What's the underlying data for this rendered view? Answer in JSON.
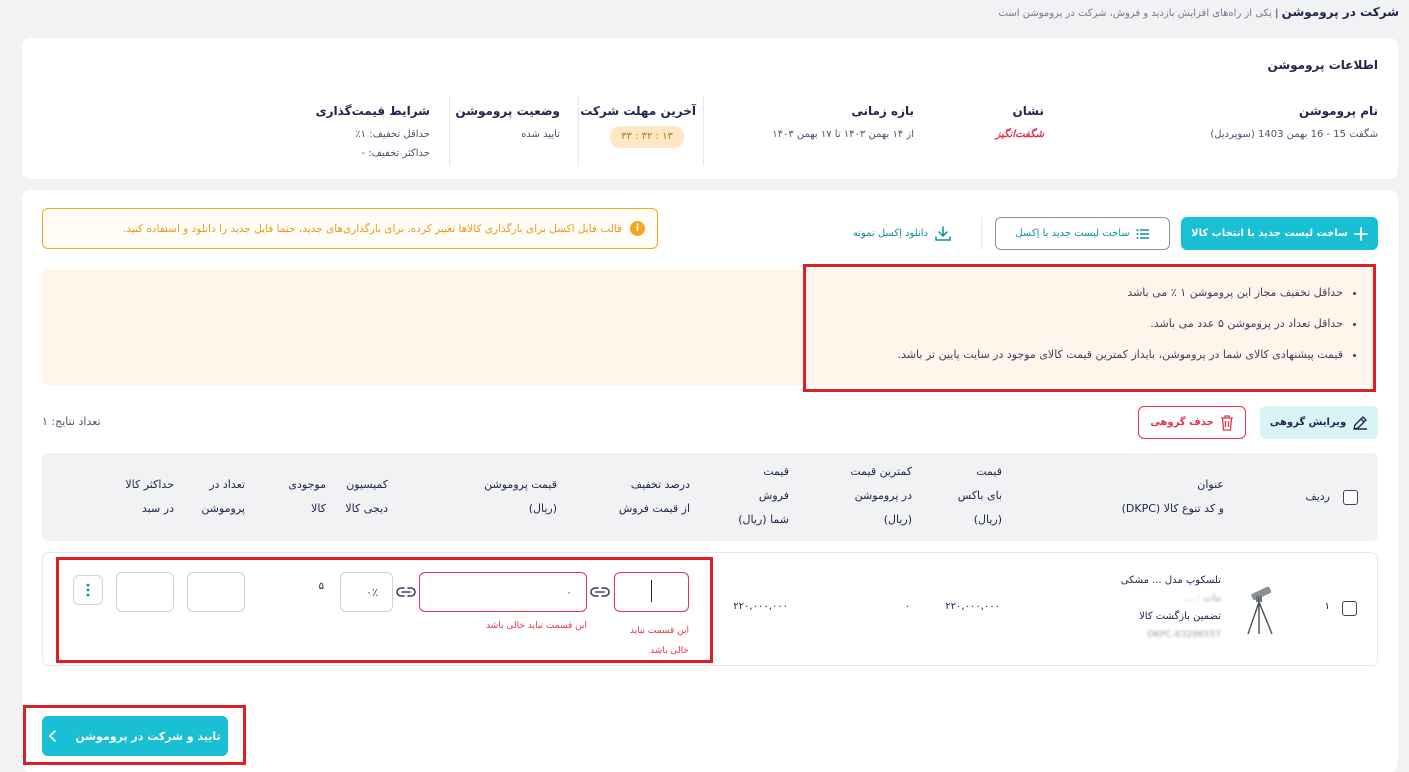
{
  "page": {
    "title": "شرکت در پروموشن",
    "subtitle": "یکی از راه‌های افزایش بازدید و فروش، شرکت در پروموشن است"
  },
  "info": {
    "heading": "اطلاعات پروموشن",
    "name_label": "نام پروموشن",
    "name_value": "شگفت 15 - 16 بهمن 1403 (سوپردیل)",
    "badge_label": "نشان",
    "badge_value": "شگفت‌انگیز",
    "period_label": "بازه زمانی",
    "period_value": "از ۱۴ بهمن ۱۴۰۳ تا ۱۷ بهمن ۱۴۰۳",
    "deadline_label": "آخرین مهلت شرکت",
    "deadline_value": "۱۳ : ۳۲ : ۳۳",
    "status_label": "وضعیت پروموشن",
    "status_value": "تایید شده",
    "pricing_label": "شرایط قیمت‌گذاری",
    "min_discount": "حداقل تخفیف: ۱٪",
    "max_discount": "حداکثر تخفیف: -"
  },
  "toolbar": {
    "new_list_label": "ساخت لیست جدید با انتخاب کالا",
    "excel_list_label": "ساخت لیست جدید با اِکسل",
    "download_label": "دانلود اِکسل نمونه",
    "warning_text": "قالب فایل اکسل برای بارگذاری کالاها تغییر کرده. برای بارگذاری‌های جدید، حتما فایل جدید را دانلود و استفاده کنید."
  },
  "rules": [
    "حداقل تخفیف مجاز این پروموشن ۱ ٪ می باشد",
    "حداقل تعداد در پروموشن ۵ عدد می باشد.",
    "قیمت پیشنهادی کالای شما در پروموشن، بایداز کمترین قیمت کالای موجود در سایت پایین تر باشد."
  ],
  "actions": {
    "bulk_edit": "ویرایش گروهی",
    "bulk_delete": "حذف گروهی",
    "results_count": "تعداد نتایج: ۱"
  },
  "table": {
    "headers": {
      "row": "ردیف",
      "title_1": "عنوان",
      "title_2": "و کد تنوع کالا (DKPC)",
      "buybox_1": "قیمت",
      "buybox_2": "بای باکس",
      "buybox_3": "(ریال)",
      "minprice_1": "کمترین قیمت",
      "minprice_2": "در پروموشن",
      "minprice_3": "(ریال)",
      "sell_1": "قیمت",
      "sell_2": "فروش",
      "sell_3": "شما (ریال)",
      "discount_1": "درصد تخفیف",
      "discount_2": "از قیمت فروش",
      "promo_price_1": "قیمت پروموشن",
      "promo_price_2": "(ریال)",
      "commission_1": "کمیسیون",
      "commission_2": "دیجی کالا",
      "stock_1": "موجودی",
      "stock_2": "کالا",
      "qty_1": "تعداد در",
      "qty_2": "پروموشن",
      "max_1": "حداکثر کالا",
      "max_2": "در سبد"
    },
    "rows": [
      {
        "index": "۱",
        "title_line_1": "تلسکوپ مدل ... مشکی",
        "title_line_2": "مات : ...",
        "title_line_3": "تضمین بازگشت کالا",
        "dkpc": "DKPC-63286557",
        "buybox_price": "۲۲۰,۰۰۰,۰۰۰",
        "min_price": "۰",
        "sell_price": "۲۲۰,۰۰۰,۰۰۰",
        "discount_value": "",
        "promo_price_value": "۰",
        "commission_value": "۰٪",
        "stock": "۵",
        "qty_value": "",
        "max_value": "",
        "discount_error": "این قسمت نباید",
        "discount_error_2": "خالی باشد",
        "price_error": "این قسمت نباید خالی باشد"
      }
    ]
  },
  "submit": {
    "label": "تایید و شرکت در پروموشن"
  },
  "colors": {
    "primary": "#19bfd3",
    "danger": "#e5324d",
    "warning": "#f9a825",
    "highlight_border": "#e01e26"
  }
}
